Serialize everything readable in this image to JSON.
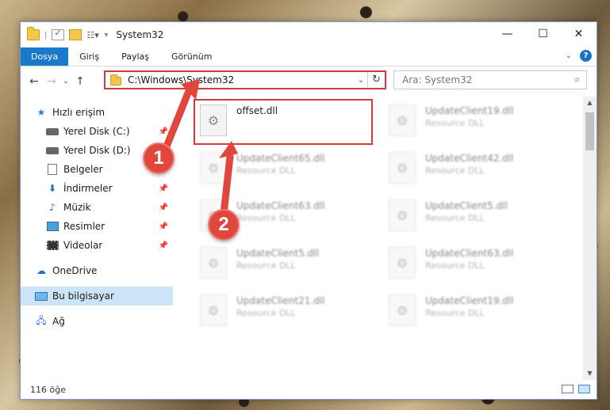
{
  "window": {
    "title": "System32"
  },
  "ribbon": {
    "tabs": [
      "Dosya",
      "Giriş",
      "Paylaş",
      "Görünüm"
    ],
    "help": "?"
  },
  "address": {
    "path": "C:\\Windows\\System32",
    "search_placeholder": "Ara: System32"
  },
  "sidebar": {
    "quick_access": "Hızlı erişim",
    "items": [
      {
        "label": "Yerel Disk (C:)",
        "pinned": true
      },
      {
        "label": "Yerel Disk (D:)",
        "pinned": false
      },
      {
        "label": "Belgeler",
        "pinned": true
      },
      {
        "label": "İndirmeler",
        "pinned": true
      },
      {
        "label": "Müzik",
        "pinned": true
      },
      {
        "label": "Resimler",
        "pinned": true
      },
      {
        "label": "Videolar",
        "pinned": true
      }
    ],
    "onedrive": "OneDrive",
    "this_pc": "Bu bilgisayar",
    "network": "Ağ"
  },
  "files": [
    {
      "name": "offset.dll",
      "type": ""
    },
    {
      "name": "UpdateClient19.dll",
      "type": "Resource DLL"
    },
    {
      "name": "UpdateClient65.dll",
      "type": "Resource DLL"
    },
    {
      "name": "UpdateClient42.dll",
      "type": "Resource DLL"
    },
    {
      "name": "UpdateClient63.dll",
      "type": "Resource DLL"
    },
    {
      "name": "UpdateClient5.dll",
      "type": "Resource DLL"
    },
    {
      "name": "UpdateClient5.dll",
      "type": "Resource DLL"
    },
    {
      "name": "UpdateClient63.dll",
      "type": "Resource DLL"
    },
    {
      "name": "UpdateClient21.dll",
      "type": "Resource DLL"
    },
    {
      "name": "UpdateClient19.dll",
      "type": "Resource DLL"
    }
  ],
  "status": {
    "count": "116 öğe"
  },
  "callouts": [
    "1",
    "2"
  ],
  "colors": {
    "accent": "#1979ca",
    "highlight": "#d9363e",
    "selection": "#cce4f7"
  }
}
